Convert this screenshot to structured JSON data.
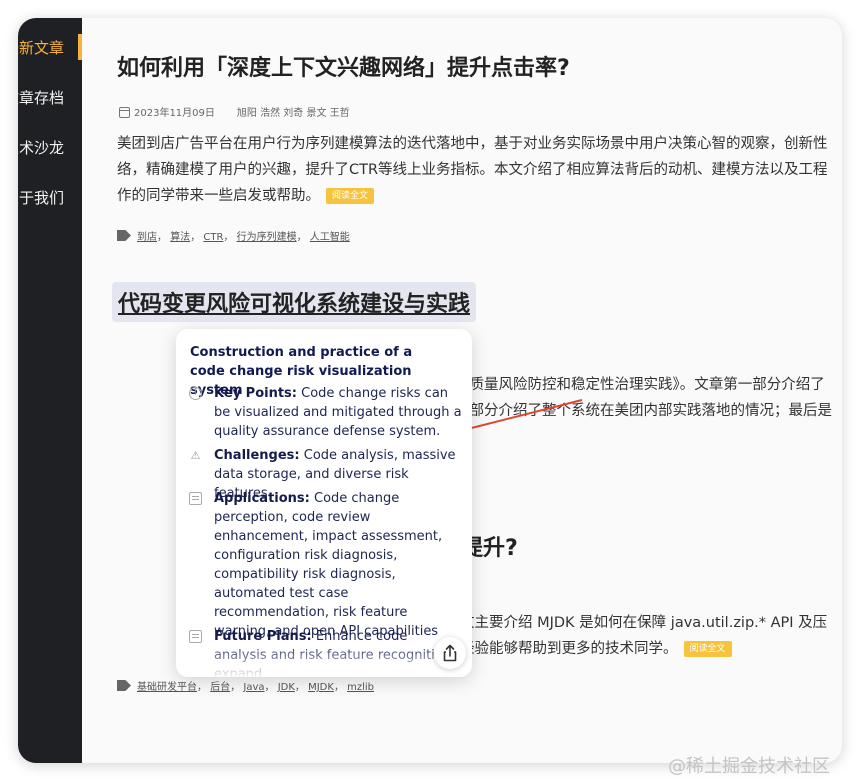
{
  "sidebar": {
    "items": [
      {
        "label": "最新文章",
        "active": true
      },
      {
        "label": "文章存档",
        "active": false
      },
      {
        "label": "技术沙龙",
        "active": false
      },
      {
        "label": "关于我们",
        "active": false
      }
    ]
  },
  "article1": {
    "title": "如何利用「深度上下文兴趣网络」提升点击率?",
    "date": "2023年11月09日",
    "authors": "旭阳 浩然 刘奇 景文 王哲",
    "body": [
      "美团到店广告平台在用户行为序列建模算法的迭代落地中，基于对业务实际场景中用户决策心智的观察，创新性",
      "络，精确建模了用户的兴趣，提升了CTR等线上业务指标。本文介绍了相应算法背后的动机、建模方法以及工程",
      "作的同学带来一些启发或帮助。"
    ],
    "read_more": "阅读全文",
    "tags": [
      "到店",
      "算法",
      "CTR",
      "行为序列建模",
      "人工智能"
    ]
  },
  "article2": {
    "title": "代码变更风险可视化系统建设与实践",
    "body_visible": [
      "流量系统的质量风险防控和稳定性治理实践》。文章第一部分介绍了",
      "建设；第三部分介绍了整个系统在美团内部实践落地的情况；最后是"
    ]
  },
  "article3": {
    "title_visible": "5 倍提升?",
    "body_visible": [
      "行版。本文主要介绍 MJDK 是如何在保障 java.util.zip.* API 及压",
      "望相关的经验能够帮助到更多的技术同学。"
    ],
    "read_more": "阅读全文",
    "tags": [
      "基础研发平台",
      "后台",
      "Java",
      "JDK",
      "MJDK",
      "mzlib"
    ]
  },
  "popup": {
    "title": "Construction and practice of a code change risk visualization system",
    "items": [
      {
        "icon": "info-icon",
        "heading": "Key Points:",
        "text": "Code change risks can be visualized and mitigated through a quality assurance defense system."
      },
      {
        "icon": "warning-icon",
        "heading": "Challenges:",
        "text": "Code analysis, massive data storage, and diverse risk features"
      },
      {
        "icon": "document-icon",
        "heading": "Applications:",
        "text": "Code change perception, code review enhancement, impact assessment, configuration risk diagnosis, compatibility risk diagnosis, automated test case recommendation, risk feature warning, and open API capabilities"
      },
      {
        "icon": "arrow-right-icon",
        "heading": "Future Plans:",
        "text": "Enhance code analysis and risk feature recognition, expand"
      }
    ],
    "share_icon": "share-icon"
  },
  "watermark": "@稀土掘金技术社区",
  "colors": {
    "sidebar_bg": "#1f2024",
    "accent": "#f6b23c",
    "badge": "#f6c33c",
    "popup_text": "#1d2551",
    "annotation_arrow": "#e0452f"
  }
}
